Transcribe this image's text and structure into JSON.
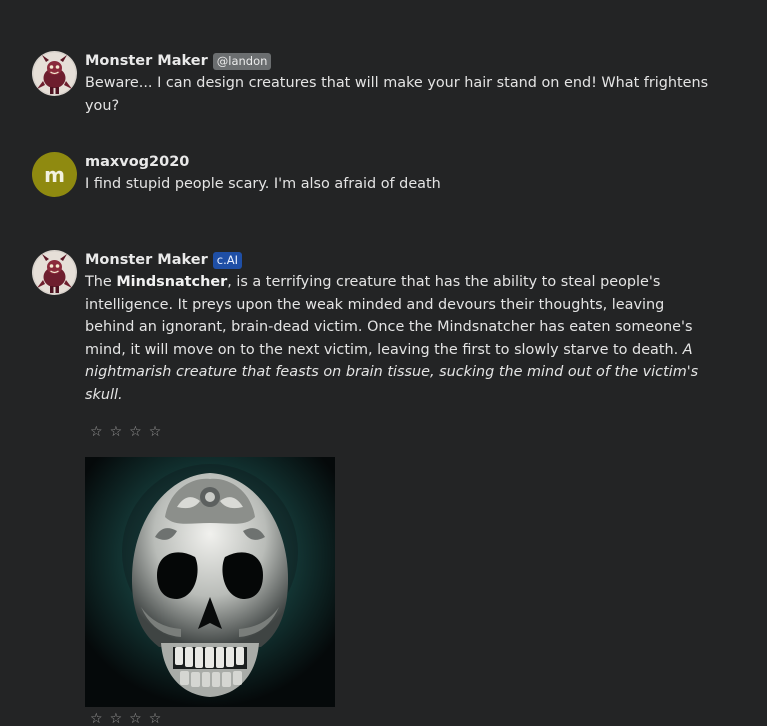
{
  "messages": [
    {
      "author": "Monster Maker",
      "badge": "@landon",
      "text": "Beware... I can design creatures that will make your hair stand on end! What frightens you?"
    },
    {
      "author": "maxvog2020",
      "avatar_letter": "m",
      "text": "I find stupid people scary. I'm also afraid of death"
    },
    {
      "author": "Monster Maker",
      "badge": "c.AI",
      "text_intro": "The ",
      "text_bold": "Mindsnatcher",
      "text_main": ", is a terrifying creature that has the ability to steal people's intelligence. It preys upon the weak minded and devours their thoughts, leaving behind an ignorant, brain-dead victim. Once the Mindsnatcher has eaten someone's mind, it will move on to the next victim, leaving the first to slowly starve to death. ",
      "text_italic": "A nightmarish creature that feasts on brain tissue, sucking the mind out of the victim's skull.",
      "rating_stars": [
        "☆",
        "☆",
        "☆",
        "☆"
      ],
      "image_rating_stars": [
        "☆",
        "☆",
        "☆",
        "☆"
      ]
    }
  ],
  "colors": {
    "background": "#232425",
    "user_avatar": "#8f8a10",
    "ai_badge": "#1f4fa6",
    "user_badge": "#6b6e70"
  },
  "icons": {
    "bot_avatar": "monster-avatar-icon",
    "generated_image": "skull-image",
    "star": "star-outline-icon"
  }
}
